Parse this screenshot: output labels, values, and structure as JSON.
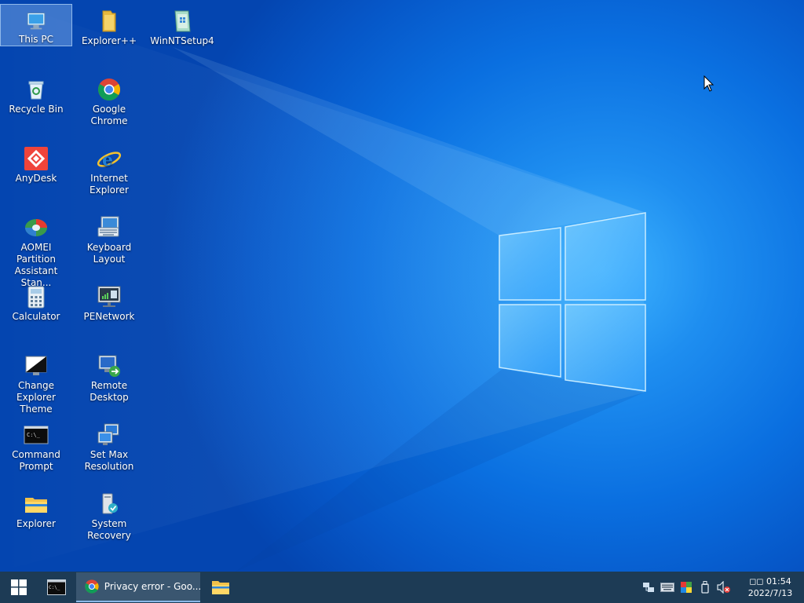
{
  "desktop": {
    "icons": [
      {
        "label": "This PC"
      },
      {
        "label": "Explorer++"
      },
      {
        "label": "WinNTSetup4"
      },
      {
        "label": "Recycle Bin"
      },
      {
        "label": "Google Chrome"
      },
      {
        "label": "AnyDesk"
      },
      {
        "label": "Internet Explorer"
      },
      {
        "label": "AOMEI Partition Assistant Stan..."
      },
      {
        "label": "Keyboard Layout"
      },
      {
        "label": "Calculator"
      },
      {
        "label": "PENetwork"
      },
      {
        "label": "Change Explorer Theme"
      },
      {
        "label": "Remote Desktop"
      },
      {
        "label": "Command Prompt"
      },
      {
        "label": "Set Max Resolution"
      },
      {
        "label": "Explorer"
      },
      {
        "label": "System Recovery"
      }
    ]
  },
  "taskbar": {
    "chrome_task_label": "Privacy error - Goo...",
    "clock": {
      "time": "◻◻ 01:54",
      "date": "2022/7/13"
    }
  },
  "colors": {
    "taskbar": "#1d3b55",
    "desktop_blue": "#0a6fe0"
  }
}
